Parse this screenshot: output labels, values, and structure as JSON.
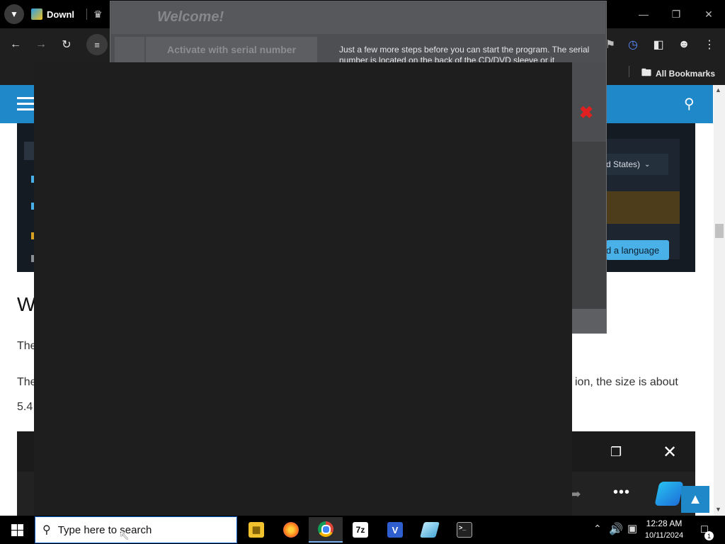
{
  "browser": {
    "tab_title": "Downl",
    "bookmarks_label": "All Bookmarks",
    "icons": {
      "tab_menu": "chevron-down-icon",
      "back": "back-arrow-icon",
      "forward": "forward-arrow-icon",
      "reload": "reload-icon",
      "site_info": "tune-icon",
      "folder": "folder-icon"
    }
  },
  "dialog": {
    "title": "Welcome!",
    "tab_label": "Activate with serial number",
    "description": "Just a few more steps before you can start the program. The serial number is located on the back of the CD/DVD sleeve or it",
    "close_color": "#e02020"
  },
  "page": {
    "accent_color": "#1e88c8",
    "language_select": "d States)",
    "language_button": "d a language",
    "heading_fragment": "W",
    "para1_fragment": "The",
    "para2_start": "The",
    "para2_end": "ion, the size is about",
    "para3_fragment": "5.4"
  },
  "taskbar": {
    "search_placeholder": "Type here to search",
    "apps": [
      {
        "name": "File Explorer",
        "icon": "folder-icon",
        "color": "#f2c12e"
      },
      {
        "name": "Firefox",
        "icon": "firefox-icon",
        "color": "#ff7a1a"
      },
      {
        "name": "Chrome",
        "icon": "chrome-icon",
        "color": "#4285f4",
        "active": true
      },
      {
        "name": "7-Zip",
        "icon": "7zip-icon",
        "label": "7z",
        "color": "#ffffff"
      },
      {
        "name": "Veeam",
        "icon": "v-app-icon",
        "label": "V",
        "color": "#2f5fcf"
      },
      {
        "name": "App",
        "icon": "blue-box-icon",
        "color": "#7bd0f2"
      },
      {
        "name": "Terminal",
        "icon": "terminal-icon",
        "color": "#222222"
      }
    ],
    "time": "12:28 AM",
    "date": "10/11/2024",
    "notification_count": "1"
  }
}
